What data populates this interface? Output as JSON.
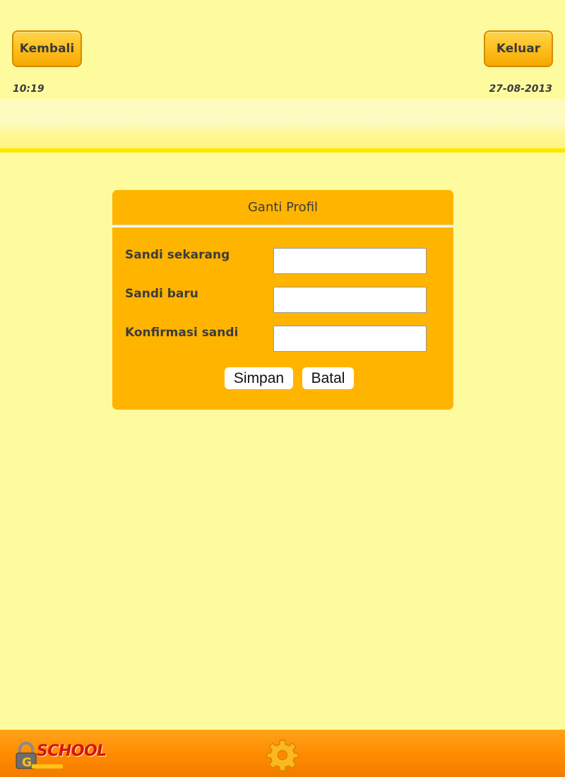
{
  "header": {
    "back_label": "Kembali",
    "logout_label": "Keluar",
    "time": "10:19",
    "date": "27-08-2013"
  },
  "dialog": {
    "title": "Ganti Profil",
    "fields": [
      {
        "label": "Sandi sekarang",
        "value": ""
      },
      {
        "label": "Sandi baru",
        "value": ""
      },
      {
        "label": "Konfirmasi sandi",
        "value": ""
      }
    ],
    "save_label": "Simpan",
    "cancel_label": "Batal"
  },
  "footer": {
    "logo_text": "SCHOOL",
    "settings_icon": "gear-icon"
  },
  "colors": {
    "background": "#fefb9f",
    "dialog": "#ffb400",
    "button": "#ffbf1f",
    "footer": "#ff8a00",
    "logo_red": "#d41414"
  }
}
